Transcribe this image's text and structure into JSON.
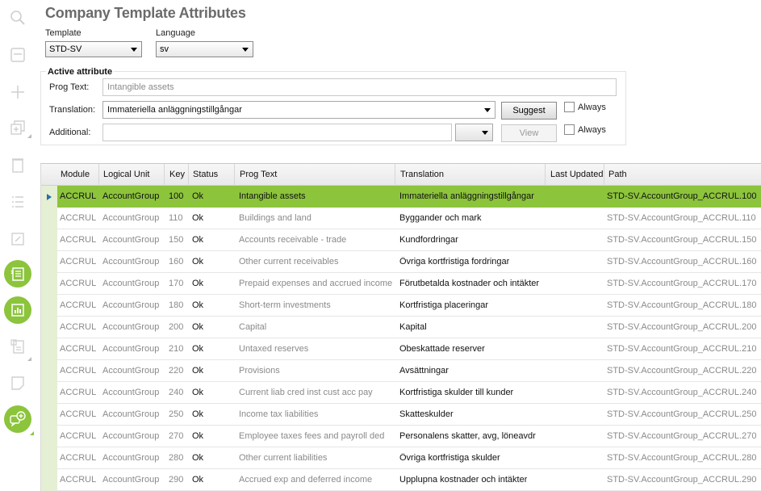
{
  "page": {
    "title": "Company Template Attributes"
  },
  "toolbar": {
    "icons": [
      "search-icon",
      "save-icon",
      "add-icon",
      "copy-icon",
      "delete-icon",
      "list-icon",
      "external-link-icon",
      "details-icon",
      "chart-icon",
      "document-icon",
      "note-icon",
      "chat-add-icon"
    ],
    "accent": "#8cc43c"
  },
  "filters": {
    "template_label": "Template",
    "template_value": "STD-SV",
    "language_label": "Language",
    "language_value": "sv"
  },
  "active_attribute": {
    "section_title": "Active attribute",
    "prog_text_label": "Prog Text:",
    "prog_text_value": "Intangible assets",
    "translation_label": "Translation:",
    "translation_value": "Immateriella anläggningstillgångar",
    "suggest_label": "Suggest",
    "always_label": "Always",
    "additional_label": "Additional:",
    "additional_value": "",
    "view_label": "View",
    "always2_label": "Always"
  },
  "grid": {
    "columns": [
      "Module",
      "Logical Unit",
      "Key",
      "Status",
      "Prog Text",
      "Translation",
      "Last Updated",
      "Path"
    ],
    "rows": [
      {
        "module": "ACCRUL",
        "lu": "AccountGroup",
        "key": "100",
        "status": "Ok",
        "prog": "Intangible assets",
        "translation": "Immateriella anläggningstillgångar",
        "updated": "",
        "path": "STD-SV.AccountGroup_ACCRUL.100",
        "selected": true
      },
      {
        "module": "ACCRUL",
        "lu": "AccountGroup",
        "key": "110",
        "status": "Ok",
        "prog": "Buildings and land",
        "translation": "Byggander och mark",
        "updated": "",
        "path": "STD-SV.AccountGroup_ACCRUL.110"
      },
      {
        "module": "ACCRUL",
        "lu": "AccountGroup",
        "key": "150",
        "status": "Ok",
        "prog": "Accounts receivable - trade",
        "translation": "Kundfordringar",
        "updated": "",
        "path": "STD-SV.AccountGroup_ACCRUL.150"
      },
      {
        "module": "ACCRUL",
        "lu": "AccountGroup",
        "key": "160",
        "status": "Ok",
        "prog": "Other current receivables",
        "translation": "Övriga kortfristiga fordringar",
        "updated": "",
        "path": "STD-SV.AccountGroup_ACCRUL.160"
      },
      {
        "module": "ACCRUL",
        "lu": "AccountGroup",
        "key": "170",
        "status": "Ok",
        "prog": "Prepaid expenses and accrued income",
        "translation": "Förutbetalda kostnader och intäkter",
        "updated": "",
        "path": "STD-SV.AccountGroup_ACCRUL.170"
      },
      {
        "module": "ACCRUL",
        "lu": "AccountGroup",
        "key": "180",
        "status": "Ok",
        "prog": "Short-term investments",
        "translation": "Kortfristiga placeringar",
        "updated": "",
        "path": "STD-SV.AccountGroup_ACCRUL.180"
      },
      {
        "module": "ACCRUL",
        "lu": "AccountGroup",
        "key": "200",
        "status": "Ok",
        "prog": "Capital",
        "translation": "Kapital",
        "updated": "",
        "path": "STD-SV.AccountGroup_ACCRUL.200"
      },
      {
        "module": "ACCRUL",
        "lu": "AccountGroup",
        "key": "210",
        "status": "Ok",
        "prog": "Untaxed reserves",
        "translation": "Obeskattade reserver",
        "updated": "",
        "path": "STD-SV.AccountGroup_ACCRUL.210"
      },
      {
        "module": "ACCRUL",
        "lu": "AccountGroup",
        "key": "220",
        "status": "Ok",
        "prog": "Provisions",
        "translation": "Avsättningar",
        "updated": "",
        "path": "STD-SV.AccountGroup_ACCRUL.220"
      },
      {
        "module": "ACCRUL",
        "lu": "AccountGroup",
        "key": "240",
        "status": "Ok",
        "prog": "Current liab cred inst cust acc pay",
        "translation": "Kortfristiga skulder till kunder",
        "updated": "",
        "path": "STD-SV.AccountGroup_ACCRUL.240"
      },
      {
        "module": "ACCRUL",
        "lu": "AccountGroup",
        "key": "250",
        "status": "Ok",
        "prog": "Income tax liabilities",
        "translation": "Skatteskulder",
        "updated": "",
        "path": "STD-SV.AccountGroup_ACCRUL.250"
      },
      {
        "module": "ACCRUL",
        "lu": "AccountGroup",
        "key": "270",
        "status": "Ok",
        "prog": "Employee taxes fees and payroll ded",
        "translation": "Personalens skatter, avg, löneavdr",
        "updated": "",
        "path": "STD-SV.AccountGroup_ACCRUL.270"
      },
      {
        "module": "ACCRUL",
        "lu": "AccountGroup",
        "key": "280",
        "status": "Ok",
        "prog": "Other current liabilities",
        "translation": "Övriga kortfristiga skulder",
        "updated": "",
        "path": "STD-SV.AccountGroup_ACCRUL.280"
      },
      {
        "module": "ACCRUL",
        "lu": "AccountGroup",
        "key": "290",
        "status": "Ok",
        "prog": "Accrued exp and deferred income",
        "translation": "Upplupna kostnader och intäkter",
        "updated": "",
        "path": "STD-SV.AccountGroup_ACCRUL.290"
      }
    ]
  }
}
